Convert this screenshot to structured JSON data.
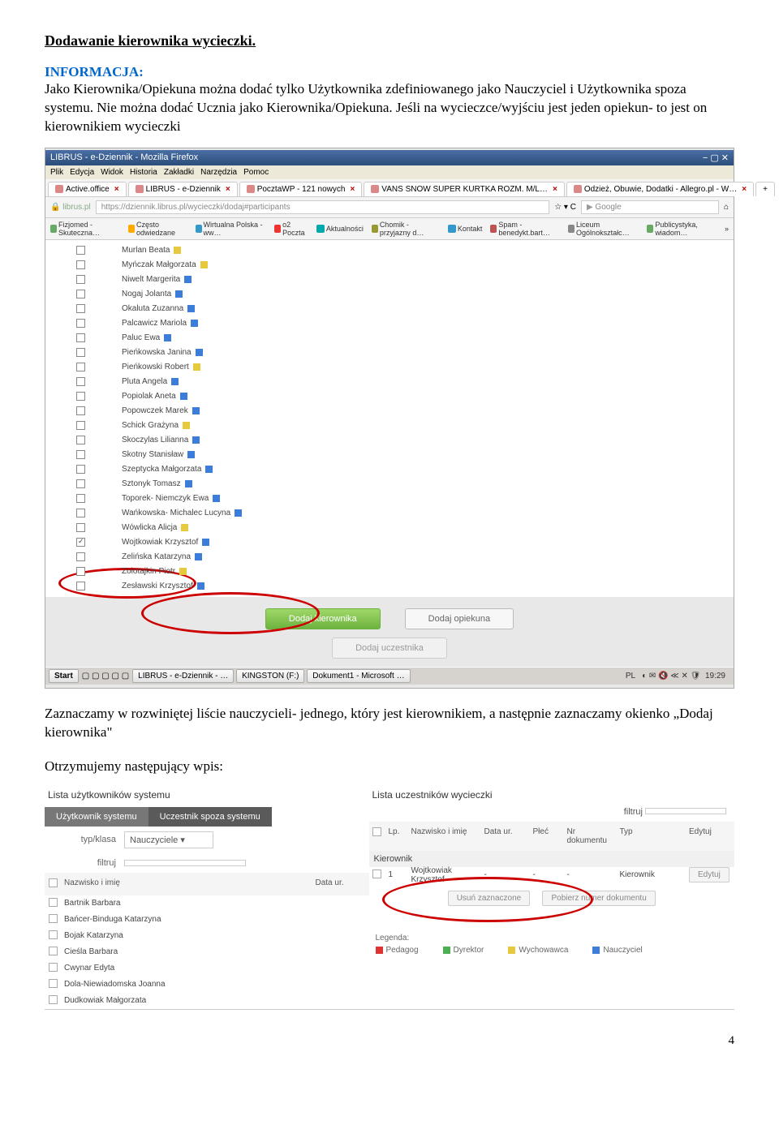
{
  "heading": "Dodawanie kierownika wycieczki.",
  "info_label": "INFORMACJA:",
  "info_body": "Jako Kierownika/Opiekuna można dodać tylko Użytkownika zdefiniowanego jako Nauczyciel i Użytkownika spoza systemu. Nie można dodać Ucznia jako Kierownika/Opiekuna. Jeśli na wycieczce/wyjściu jest jeden opiekun- to jest on kierownikiem wycieczki",
  "para2": "Zaznaczamy w rozwiniętej liście nauczycieli- jednego, który jest kierownikiem, a następnie zaznaczamy okienko „Dodaj kierownika\"",
  "para3": "Otrzymujemy następujący wpis:",
  "page_number": "4",
  "shot1": {
    "window_title": "LIBRUS - e-Dziennik - Mozilla Firefox",
    "menu": [
      "Plik",
      "Edycja",
      "Widok",
      "Historia",
      "Zakładki",
      "Narzędzia",
      "Pomoc"
    ],
    "tabs": [
      {
        "label": "Active.office"
      },
      {
        "label": "LIBRUS - e-Dziennik"
      },
      {
        "label": "PocztaWP - 121 nowych"
      },
      {
        "label": "VANS SNOW SUPER KURTKA ROZM. M/L…"
      },
      {
        "label": "Odzież, Obuwie, Dodatki - Allegro.pl - W…"
      }
    ],
    "address": "https://dziennik.librus.pl/wycieczki/dodaj#participants",
    "search_placeholder": "Google",
    "bookmarks": [
      "Fizjomed - Skuteczna…",
      "Często odwiedzane",
      "Wirtualna Polska - ww…",
      "o2 Poczta",
      "Aktualności",
      "Chomik - przyjazny d…",
      "Kontakt",
      "Spam - benedykt.bart…",
      "Liceum Ogólnokształc…",
      "Publicystyka, wiadom…"
    ],
    "teachers": [
      {
        "name": "Murlan Beata",
        "marker": "m-yellow",
        "checked": false
      },
      {
        "name": "Myńczak Małgorzata",
        "marker": "m-yellow",
        "checked": false
      },
      {
        "name": "Niwelt Margerita",
        "marker": "m-blue",
        "checked": false
      },
      {
        "name": "Nogaj Jolanta",
        "marker": "m-blue",
        "checked": false
      },
      {
        "name": "Okaluta Zuzanna",
        "marker": "m-blue",
        "checked": false
      },
      {
        "name": "Palcawicz Mariola",
        "marker": "m-blue",
        "checked": false
      },
      {
        "name": "Paluc Ewa",
        "marker": "m-blue",
        "checked": false
      },
      {
        "name": "Pieńkowska Janina",
        "marker": "m-blue",
        "checked": false
      },
      {
        "name": "Pieńkowski Robert",
        "marker": "m-yellow",
        "checked": false
      },
      {
        "name": "Pluta Angela",
        "marker": "m-blue",
        "checked": false
      },
      {
        "name": "Popiolak Aneta",
        "marker": "m-blue",
        "checked": false
      },
      {
        "name": "Popowczek Marek",
        "marker": "m-blue",
        "checked": false
      },
      {
        "name": "Schick Grażyna",
        "marker": "m-yellow",
        "checked": false
      },
      {
        "name": "Skoczylas Lilianna",
        "marker": "m-blue",
        "checked": false
      },
      {
        "name": "Skotny Stanisław",
        "marker": "m-blue",
        "checked": false
      },
      {
        "name": "Szeptycka Małgorzata",
        "marker": "m-blue",
        "checked": false
      },
      {
        "name": "Sztonyk Tomasz",
        "marker": "m-blue",
        "checked": false
      },
      {
        "name": "Toporek- Niemczyk Ewa",
        "marker": "m-blue",
        "checked": false
      },
      {
        "name": "Wańkowska- Michalec Lucyna",
        "marker": "m-blue",
        "checked": false
      },
      {
        "name": "Wówlicka Alicja",
        "marker": "m-yellow",
        "checked": false
      },
      {
        "name": "Wojtkowiak Krzysztof",
        "marker": "m-blue",
        "checked": true
      },
      {
        "name": "Zelińska Katarzyna",
        "marker": "m-blue",
        "checked": false
      },
      {
        "name": "Zolotajkin Piotr",
        "marker": "m-yellow",
        "checked": false
      },
      {
        "name": "Zesławski Krzysztof",
        "marker": "m-blue",
        "checked": false
      }
    ],
    "btn_add_leader": "Dodaj kierownika",
    "btn_add_guardian": "Dodaj opiekuna",
    "btn_add_participant": "Dodaj uczestnika",
    "taskbar": {
      "start": "Start",
      "items": [
        "LIBRUS - e-Dziennik - …",
        "KINGSTON (F:)",
        "Dokument1 - Microsoft …"
      ],
      "lang": "PL",
      "clock": "19:29"
    }
  },
  "shot2": {
    "left_title": "Lista użytkowników systemu",
    "right_title": "Lista uczestników wycieczki",
    "tab_user": "Użytkownik systemu",
    "tab_external": "Uczestnik spoza systemu",
    "type_label": "typ/klasa",
    "type_value": "Nauczyciele",
    "filter_label": "filtruj",
    "left_headers": {
      "name": "Nazwisko i imię",
      "dob": "Data ur."
    },
    "right_headers": {
      "lp": "Lp.",
      "name": "Nazwisko i imię",
      "dob": "Data ur.",
      "sex": "Płeć",
      "doc": "Nr dokumentu",
      "type": "Typ",
      "edit": "Edytuj"
    },
    "right_filter": "filtruj",
    "kier_section": "Kierownik",
    "participant": {
      "lp": "1",
      "name": "Wojtkowiak Krzysztof",
      "dob": "-",
      "sex": "-",
      "doc": "-",
      "type": "Kierownik",
      "edit": "Edytuj"
    },
    "left_rows": [
      {
        "name": "Bartnik Barbara",
        "marker": "m-yellow"
      },
      {
        "name": "Bańcer-Binduga Katarzyna",
        "marker": "m-blue"
      },
      {
        "name": "Bojak Katarzyna",
        "marker": "m-blue"
      },
      {
        "name": "Cieśla Barbara",
        "marker": "m-blue"
      },
      {
        "name": "Cwynar Edyta",
        "marker": "m-blue"
      },
      {
        "name": "Dola-Niewiadomska Joanna",
        "marker": "m-yellow"
      },
      {
        "name": "Dudkowiak Małgorzata",
        "marker": "m-blue"
      }
    ],
    "btn_delete": "Usuń zaznaczone",
    "btn_getdoc": "Pobierz numer dokumentu",
    "legend_title": "Legenda:",
    "legend": [
      {
        "cls": "sw-red",
        "label": "Pedagog"
      },
      {
        "cls": "sw-green",
        "label": "Dyrektor"
      },
      {
        "cls": "sw-yellow",
        "label": "Wychowawca"
      },
      {
        "cls": "sw-blue",
        "label": "Nauczyciel"
      }
    ]
  }
}
